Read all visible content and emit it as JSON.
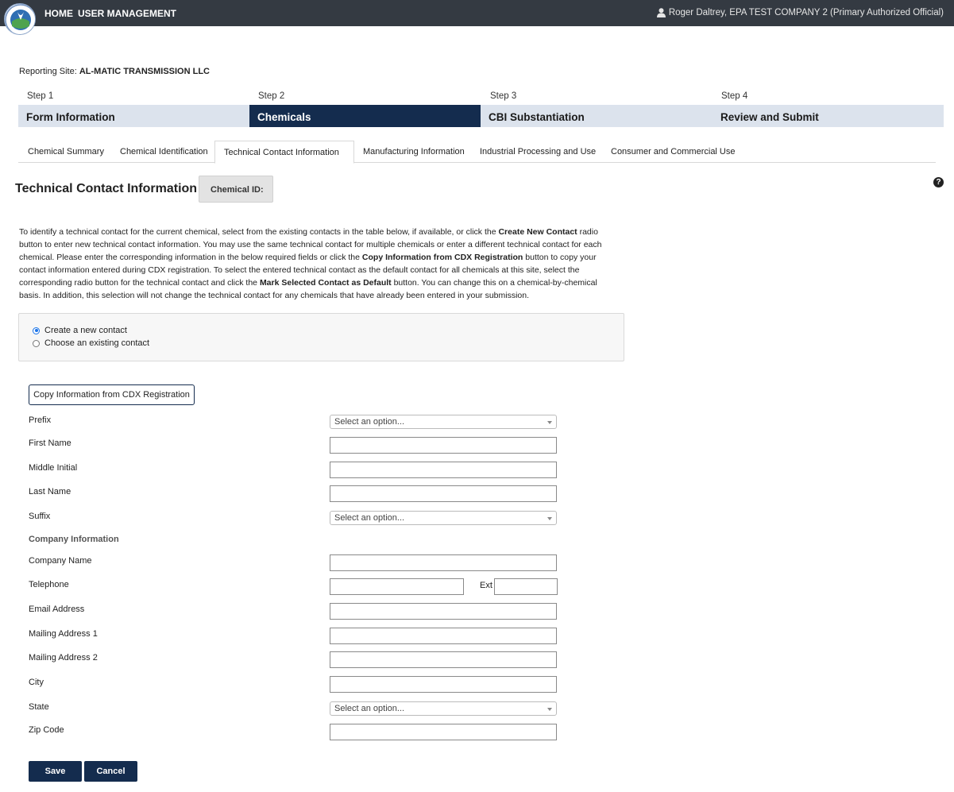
{
  "nav": {
    "home": "HOME",
    "user_management": "USER MANAGEMENT",
    "user": "Roger Daltrey, EPA TEST COMPANY 2 (Primary Authorized Official)"
  },
  "reporting_site": {
    "label": "Reporting Site:",
    "value": "AL-MATIC TRANSMISSION LLC"
  },
  "steps": [
    {
      "step": "Step 1",
      "label": "Form Information"
    },
    {
      "step": "Step 2",
      "label": "Chemicals",
      "active": true
    },
    {
      "step": "Step 3",
      "label": "CBI Substantiation"
    },
    {
      "step": "Step 4",
      "label": "Review and Submit"
    }
  ],
  "tabs": [
    "Chemical Summary",
    "Chemical Identification",
    "Technical Contact Information",
    "Manufacturing Information",
    "Industrial Processing and Use",
    "Consumer and Commercial Use"
  ],
  "active_tab": "Technical Contact Information",
  "page": {
    "title": "Technical Contact Information",
    "chemical_id_label": "Chemical ID:"
  },
  "instructions": {
    "p1": "To identify a technical contact for the current chemical, select from the existing contacts in the table below, if available, or click the ",
    "b1": "Create New Contact",
    "p2": " radio button to enter new technical contact information. You may use the same technical contact for multiple chemicals or enter a different technical contact for each chemical. Please enter the corresponding information in the below required fields or click the ",
    "b2": "Copy Information from CDX Registration",
    "p3": " button to copy your contact information entered during CDX registration. To select the entered technical contact as the default contact for all chemicals at this site, select the corresponding radio button for the technical contact and click the ",
    "b3": "Mark Selected Contact as Default",
    "p4": " button. You can change this on a chemical-by-chemical basis. In addition, this selection will not change the technical contact for any chemicals that have already been entered in your submission."
  },
  "contact_choice": {
    "options": [
      "Create a new contact",
      "Choose an existing contact"
    ],
    "selected": "Create a new contact"
  },
  "copy_button": "Copy Information from CDX Registration",
  "form": {
    "prefix": {
      "label": "Prefix",
      "value": "Select an option..."
    },
    "first_name": {
      "label": "First Name",
      "value": ""
    },
    "middle_initial": {
      "label": "Middle Initial",
      "value": ""
    },
    "last_name": {
      "label": "Last Name",
      "value": ""
    },
    "suffix": {
      "label": "Suffix",
      "value": "Select an option..."
    },
    "company_section": "Company Information",
    "company_name": {
      "label": "Company Name",
      "value": ""
    },
    "telephone": {
      "label": "Telephone",
      "value": ""
    },
    "ext": {
      "label": "Ext",
      "value": ""
    },
    "email": {
      "label": "Email Address",
      "value": ""
    },
    "mailing1": {
      "label": "Mailing Address 1",
      "value": ""
    },
    "mailing2": {
      "label": "Mailing Address 2",
      "value": ""
    },
    "city": {
      "label": "City",
      "value": ""
    },
    "state": {
      "label": "State",
      "value": "Select an option..."
    },
    "zip": {
      "label": "Zip Code",
      "value": ""
    }
  },
  "actions": {
    "save": "Save",
    "cancel": "Cancel"
  },
  "colors": {
    "navy": "#142c4e",
    "topbar": "#343a42",
    "step_bg": "#dce3ed"
  }
}
